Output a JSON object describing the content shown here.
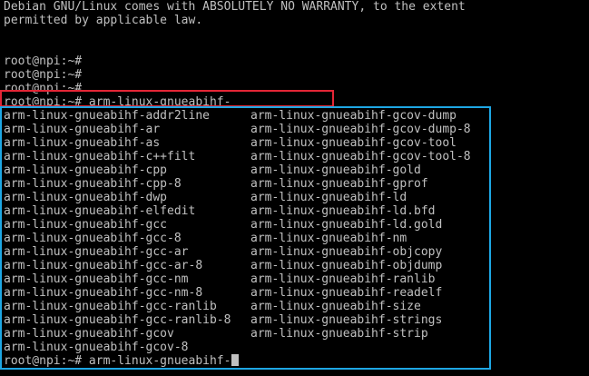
{
  "terminal": {
    "banner": [
      "Debian GNU/Linux comes with ABSOLUTELY NO WARRANTY, to the extent",
      "permitted by applicable law."
    ],
    "prompts": [
      "root@npi:~#",
      "root@npi:~#",
      "root@npi:~#"
    ],
    "command_line": "root@npi:~# arm-linux-gnueabihf-",
    "completions_left": [
      "arm-linux-gnueabihf-addr2line",
      "arm-linux-gnueabihf-ar",
      "arm-linux-gnueabihf-as",
      "arm-linux-gnueabihf-c++filt",
      "arm-linux-gnueabihf-cpp",
      "arm-linux-gnueabihf-cpp-8",
      "arm-linux-gnueabihf-dwp",
      "arm-linux-gnueabihf-elfedit",
      "arm-linux-gnueabihf-gcc",
      "arm-linux-gnueabihf-gcc-8",
      "arm-linux-gnueabihf-gcc-ar",
      "arm-linux-gnueabihf-gcc-ar-8",
      "arm-linux-gnueabihf-gcc-nm",
      "arm-linux-gnueabihf-gcc-nm-8",
      "arm-linux-gnueabihf-gcc-ranlib",
      "arm-linux-gnueabihf-gcc-ranlib-8",
      "arm-linux-gnueabihf-gcov",
      "arm-linux-gnueabihf-gcov-8"
    ],
    "completions_right": [
      "arm-linux-gnueabihf-gcov-dump",
      "arm-linux-gnueabihf-gcov-dump-8",
      "arm-linux-gnueabihf-gcov-tool",
      "arm-linux-gnueabihf-gcov-tool-8",
      "arm-linux-gnueabihf-gold",
      "arm-linux-gnueabihf-gprof",
      "arm-linux-gnueabihf-ld",
      "arm-linux-gnueabihf-ld.bfd",
      "arm-linux-gnueabihf-ld.gold",
      "arm-linux-gnueabihf-nm",
      "arm-linux-gnueabihf-objcopy",
      "arm-linux-gnueabihf-objdump",
      "arm-linux-gnueabihf-ranlib",
      "arm-linux-gnueabihf-readelf",
      "arm-linux-gnueabihf-size",
      "arm-linux-gnueabihf-strings",
      "arm-linux-gnueabihf-strip"
    ],
    "final_prompt": "root@npi:~# arm-linux-gnueabihf-"
  },
  "colors": {
    "background": "#000000",
    "foreground": "#c0c0c0",
    "highlight_red": "#e32636",
    "highlight_blue": "#1ea7e4"
  }
}
